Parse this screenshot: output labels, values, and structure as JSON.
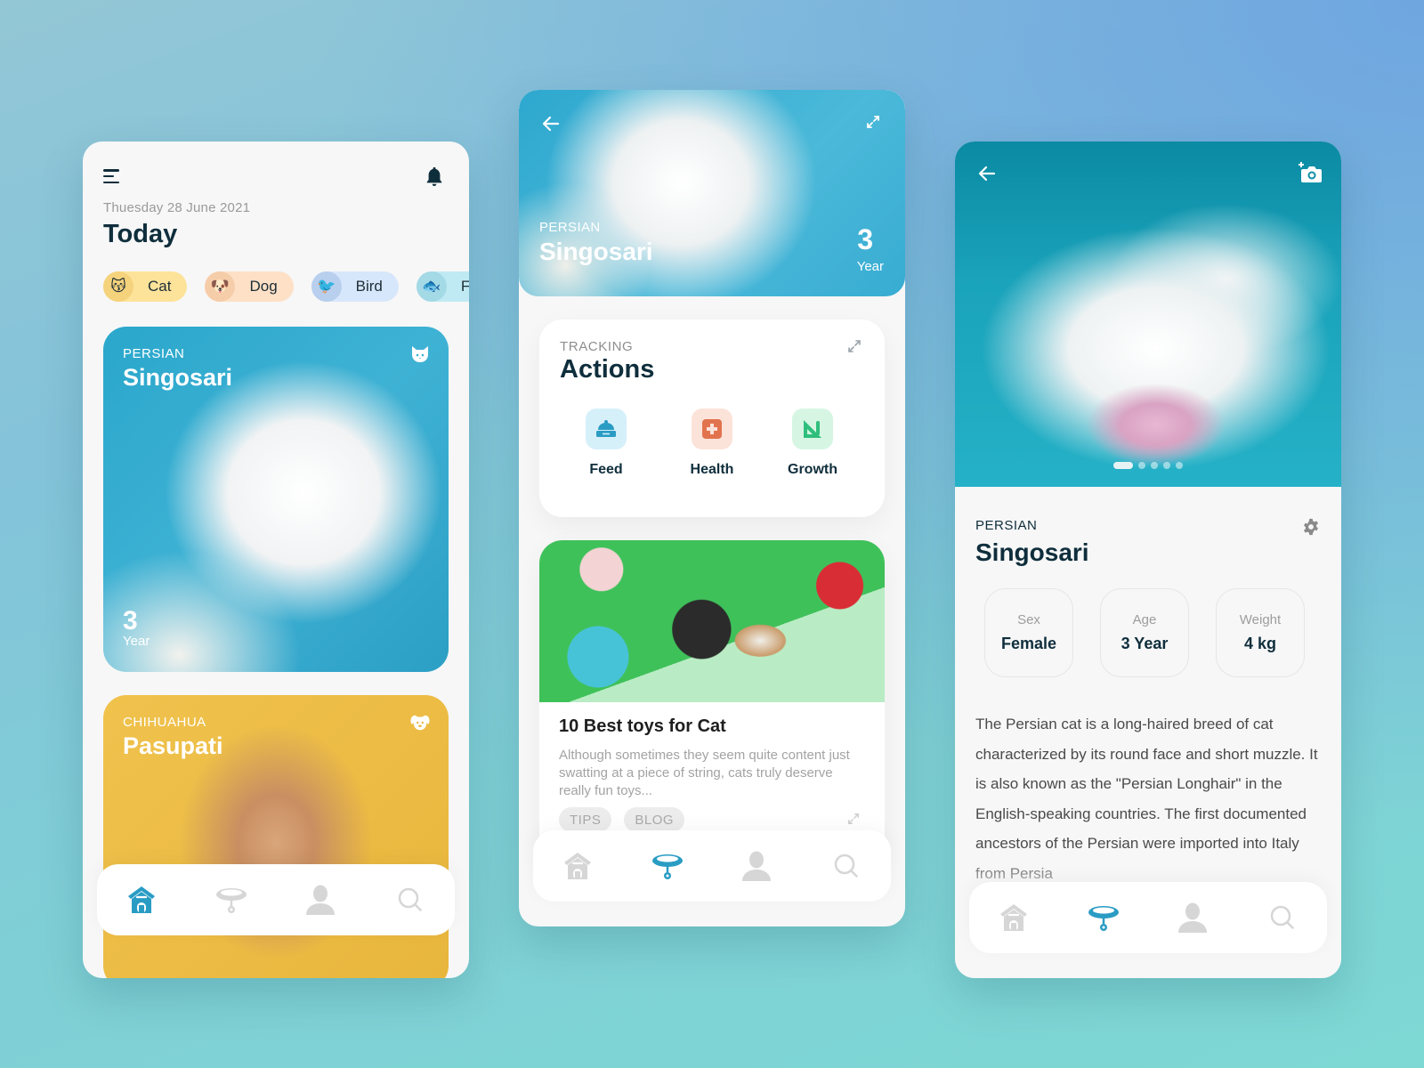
{
  "screen1": {
    "date": "Thuesday 28 June 2021",
    "title": "Today",
    "categories": [
      {
        "label": "Cat",
        "emoji": "😽",
        "bg": "#fde39a",
        "emoji_bg": "#f5d37d"
      },
      {
        "label": "Dog",
        "emoji": "🐶",
        "bg": "#fde0c6",
        "emoji_bg": "#f6cda9"
      },
      {
        "label": "Bird",
        "emoji": "🐦",
        "bg": "#d7e7fb",
        "emoji_bg": "#b8cfee"
      },
      {
        "label": "Fish",
        "emoji": "🐟",
        "bg": "#bfeaf3",
        "emoji_bg": "#a4d9e6"
      }
    ],
    "pets": [
      {
        "breed": "PERSIAN",
        "name": "Singosari",
        "age_num": "3",
        "age_unit": "Year",
        "icon": "cat-face-icon"
      },
      {
        "breed": "CHIHUAHUA",
        "name": "Pasupati",
        "icon": "dog-face-icon"
      }
    ],
    "nav_active": "home"
  },
  "screen2": {
    "hero": {
      "breed": "PERSIAN",
      "name": "Singosari",
      "age_num": "3",
      "age_unit": "Year"
    },
    "tracking": {
      "label": "TRACKING",
      "title": "Actions",
      "actions": [
        {
          "label": "Feed",
          "icon": "food-bowl-icon",
          "tile": "#d6f0fa",
          "color": "#2a9cc4"
        },
        {
          "label": "Health",
          "icon": "first-aid-icon",
          "tile": "#fbe3d9",
          "color": "#e2734f"
        },
        {
          "label": "Growth",
          "icon": "ruler-triangle-icon",
          "tile": "#d6f6e3",
          "color": "#2fbf7d"
        }
      ]
    },
    "blog": {
      "title": "10 Best toys for Cat",
      "text": "Although sometimes they seem quite content just swatting at a piece of string, cats truly deserve really fun toys...",
      "tags": [
        "TIPS",
        "BLOG"
      ]
    },
    "nav_active": "collar"
  },
  "screen3": {
    "breed": "PERSIAN",
    "name": "Singosari",
    "gallery": {
      "count": 5,
      "active_index": 0
    },
    "stats": [
      {
        "key": "Sex",
        "value": "Female"
      },
      {
        "key": "Age",
        "value": "3 Year"
      },
      {
        "key": "Weight",
        "value": "4 kg"
      }
    ],
    "description": "The Persian cat is a long-haired breed of cat characterized by its round face and short muzzle. It is also known as the \"Persian Longhair\" in the English-speaking countries. The first documented ancestors of the Persian were imported into Italy from Persia",
    "nav_active": "collar"
  },
  "nav": {
    "items": [
      "home",
      "collar",
      "profile",
      "search"
    ],
    "active_color": "#2a9cc4",
    "inactive_color": "#d6d6d6"
  }
}
